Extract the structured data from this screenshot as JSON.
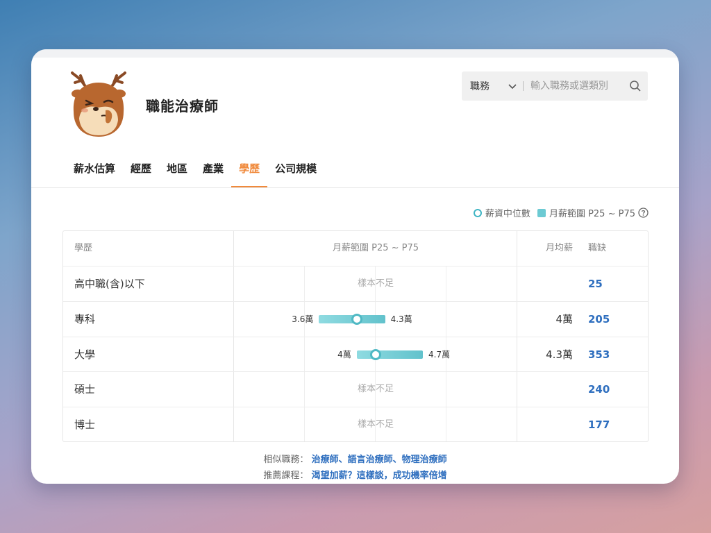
{
  "profile": {
    "title": "職能治療師"
  },
  "search": {
    "category": "職務",
    "placeholder": "輸入職務或選類別"
  },
  "tabs": [
    {
      "label": "薪水估算"
    },
    {
      "label": "經歷"
    },
    {
      "label": "地區"
    },
    {
      "label": "產業"
    },
    {
      "label": "學歷",
      "active": true
    },
    {
      "label": "公司規模"
    }
  ],
  "legend": {
    "median": "薪資中位數",
    "range": "月薪範圍 P25 ~ P75"
  },
  "table": {
    "headers": {
      "education": "學歷",
      "range": "月薪範圍 P25 ~ P75",
      "avg": "月均薪",
      "openings": "職缺"
    },
    "scale": {
      "min": 2.7,
      "max": 5.7,
      "unit": "萬"
    },
    "rows": [
      {
        "education": "高中職(含)以下",
        "insufficient": "樣本不足",
        "openings": "25"
      },
      {
        "education": "專科",
        "p25": 3.6,
        "p75": 4.3,
        "median": 4.0,
        "p25_label": "3.6萬",
        "p75_label": "4.3萬",
        "avg": "4萬",
        "openings": "205"
      },
      {
        "education": "大學",
        "p25": 4.0,
        "p75": 4.7,
        "median": 4.2,
        "p25_label": "4萬",
        "p75_label": "4.7萬",
        "avg": "4.3萬",
        "openings": "353"
      },
      {
        "education": "碩士",
        "insufficient": "樣本不足",
        "openings": "240"
      },
      {
        "education": "博士",
        "insufficient": "樣本不足",
        "openings": "177"
      }
    ]
  },
  "similar": {
    "label": "相似職務：",
    "links": "治療師、語言治療師、物理治療師"
  },
  "course": {
    "label": "推薦課程：",
    "link": "渴望加薪？這樣談，成功機率倍增"
  },
  "colors": {
    "accent": "#f08a3c",
    "bar": "#62c2cc",
    "link": "#2f6fbf"
  }
}
